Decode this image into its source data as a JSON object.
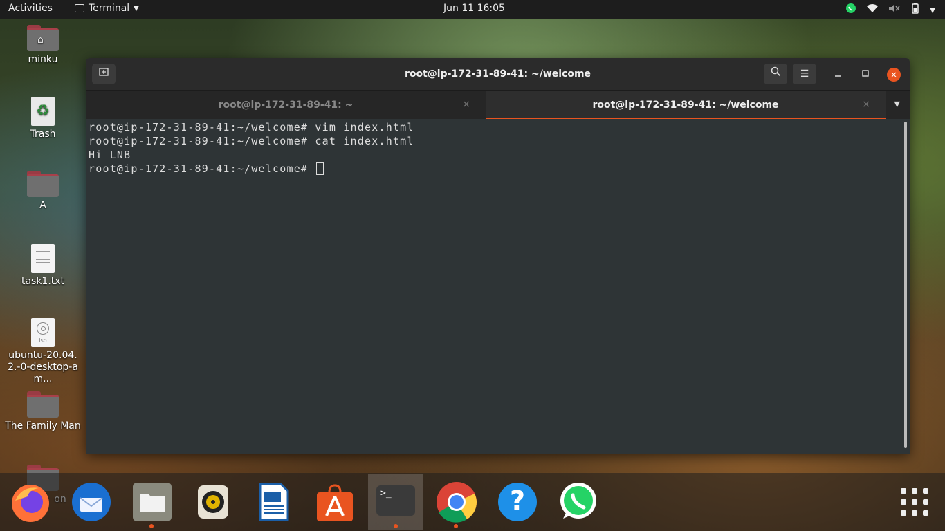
{
  "topbar": {
    "activities": "Activities",
    "app_name": "Terminal",
    "clock": "Jun 11  16:05",
    "tray_icons": [
      "whatsapp-icon",
      "wifi-icon",
      "volume-muted-icon",
      "battery-icon",
      "power-menu-icon"
    ]
  },
  "desktop": {
    "icons": [
      {
        "label": "minku",
        "type": "home-folder"
      },
      {
        "label": "Trash",
        "type": "trash"
      },
      {
        "label": "A",
        "type": "folder"
      },
      {
        "label": "task1.txt",
        "type": "text-file"
      },
      {
        "label": "ubuntu-20.04.2.-0-desktop-am...",
        "type": "iso"
      },
      {
        "label": "The Family Man",
        "type": "folder"
      },
      {
        "label": "on",
        "type": "folder"
      }
    ]
  },
  "window": {
    "title": "root@ip-172-31-89-41: ~/welcome",
    "tabs": [
      {
        "label": "root@ip-172-31-89-41: ~",
        "active": false
      },
      {
        "label": "root@ip-172-31-89-41: ~/welcome",
        "active": true
      }
    ],
    "close_glyph": "×",
    "terminal_lines": [
      "root@ip-172-31-89-41:~/welcome# vim index.html",
      "root@ip-172-31-89-41:~/welcome# cat index.html",
      "Hi LNB",
      ""
    ],
    "prompt": "root@ip-172-31-89-41:~/welcome# "
  },
  "dock": {
    "apps": [
      "Firefox",
      "Thunderbird",
      "Files",
      "Rhythmbox",
      "LibreOffice Writer",
      "Ubuntu Software",
      "Terminal",
      "Google Chrome",
      "Help",
      "WhatsApp"
    ],
    "terminal_glyph": ">_",
    "help_glyph": "?",
    "show_apps": "Show Applications"
  },
  "colors": {
    "accent": "#e95420",
    "terminal_bg": "#2e3436",
    "topbar_bg": "#1d1d1d"
  }
}
